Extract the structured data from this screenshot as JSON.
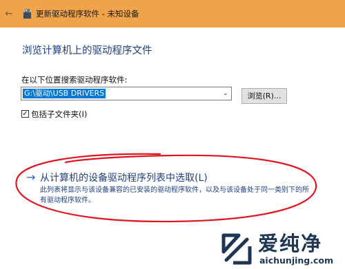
{
  "window": {
    "title": "更新驱动程序软件 - 未知设备",
    "back_icon": "back-arrow-icon",
    "app_icon": "usb-device-icon",
    "accent_color": "#f0a34a"
  },
  "main": {
    "heading": "浏览计算机上的驱动程序文件",
    "search_label": "在以下位置搜索驱动程序软件:",
    "path_value": "G:\\驱动\\USB DRIVERS",
    "browse_label": "浏览(R)...",
    "include_subfolders_label": "包括子文件夹(I)",
    "include_subfolders_checked": true
  },
  "pick_option": {
    "arrow": "→",
    "title": "从计算机的设备驱动程序列表中选取(L)",
    "description": "此列表将显示与该设备兼容的已安装的驱动程序软件，以及与该设备处于同一类别下的所有驱动程序软件。"
  },
  "annotation": {
    "color": "#e0141e"
  },
  "watermark": {
    "brand": "爱纯净",
    "url": "aichunjing.com",
    "color": "#1e3553"
  }
}
